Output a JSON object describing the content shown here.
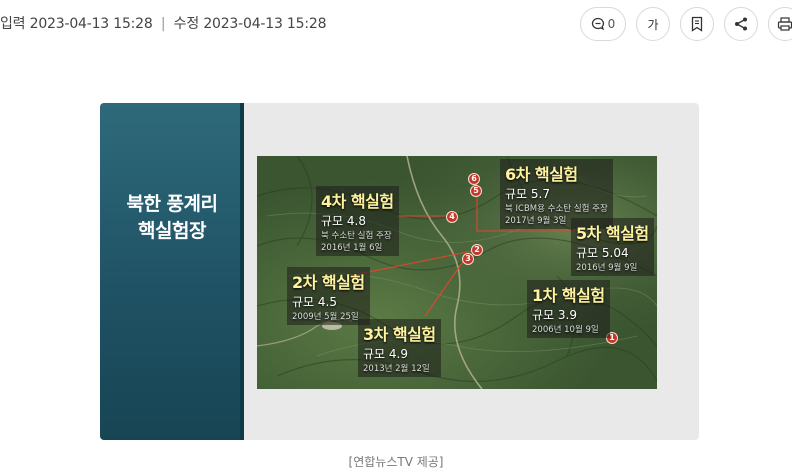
{
  "meta": {
    "input_label": "입력",
    "input_datetime": "2023-04-13 15:28",
    "separator": "|",
    "modified_label": "수정",
    "modified_datetime": "2023-04-13 15:28"
  },
  "toolbar": {
    "comment_count": "0",
    "font_label": "가"
  },
  "figure": {
    "panel_title_line1": "북한 풍계리",
    "panel_title_line2": "핵실험장",
    "tests": [
      {
        "marker": "1",
        "title": "1차 핵실험",
        "scale": "규모 3.9",
        "note": "",
        "date": "2006년 10월 9일"
      },
      {
        "marker": "2",
        "title": "2차 핵실험",
        "scale": "규모 4.5",
        "note": "",
        "date": "2009년 5월 25일"
      },
      {
        "marker": "3",
        "title": "3차 핵실험",
        "scale": "규모 4.9",
        "note": "",
        "date": "2013년 2월 12일"
      },
      {
        "marker": "4",
        "title": "4차 핵실험",
        "scale": "규모 4.8",
        "note": "북 수소탄 실험 주장",
        "date": "2016년 1월 6일"
      },
      {
        "marker": "5",
        "title": "5차 핵실험",
        "scale": "규모 5.04",
        "note": "",
        "date": "2016년 9월 9일"
      },
      {
        "marker": "6",
        "title": "6차 핵실험",
        "scale": "규모 5.7",
        "note": "북 ICBM용 수소탄 실험 주장",
        "date": "2017년 9월 3일"
      }
    ]
  },
  "caption": "[연합뉴스TV 제공]"
}
